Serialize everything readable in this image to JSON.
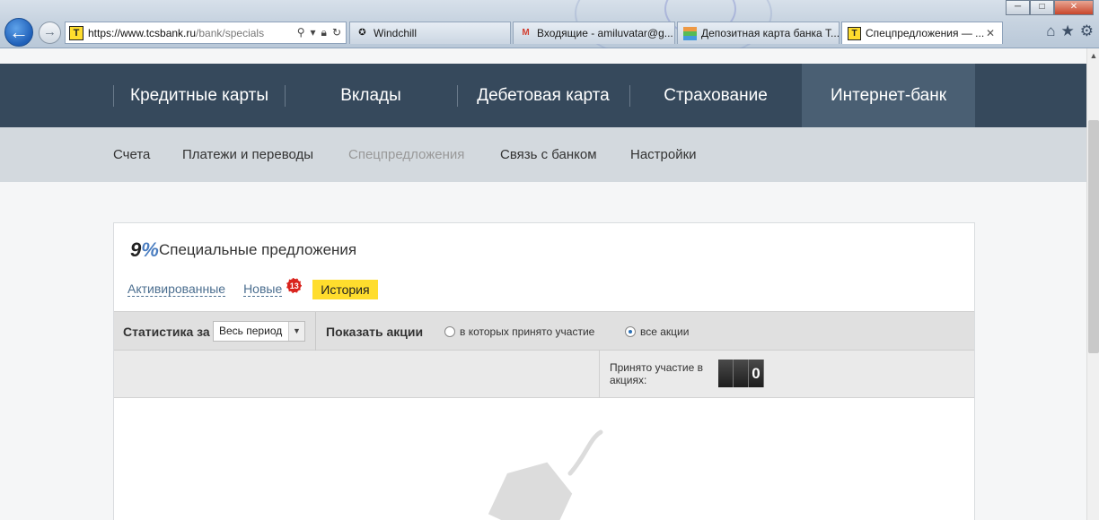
{
  "browser": {
    "address": {
      "url_host": "https://www.tcsbank.ru",
      "url_path": "/bank/specials",
      "site_icon": "T"
    },
    "tabs": [
      {
        "label": "Windchill",
        "icon": "windchill-icon"
      },
      {
        "label": "Входящие - amiluvatar@g...",
        "icon": "gmail-icon"
      },
      {
        "label": "Депозитная карта банка Т...",
        "icon": "bank-chart-icon"
      },
      {
        "label": "Спецпредложения — ...",
        "icon": "tcs-icon"
      }
    ]
  },
  "topnav": {
    "items": [
      {
        "label": "Кредитные карты"
      },
      {
        "label": "Вклады"
      },
      {
        "label": "Дебетовая карта"
      },
      {
        "label": "Страхование"
      },
      {
        "label": "Интернет-банк"
      }
    ]
  },
  "subnav": {
    "items": [
      {
        "label": "Счета"
      },
      {
        "label": "Платежи и переводы"
      },
      {
        "label": "Спецпредложения"
      },
      {
        "label": "Связь с банком"
      },
      {
        "label": "Настройки"
      }
    ]
  },
  "card": {
    "title": "Специальные предложения",
    "filters": {
      "activated": "Активированные",
      "new": "Новые",
      "new_count": "13",
      "history": "История"
    },
    "stats": {
      "label": "Статистика за",
      "period": "Весь период",
      "show_label": "Показать акции",
      "option_participated": "в которых принято участие",
      "option_all": "все акции",
      "selected": "все акции"
    },
    "counter": {
      "label": "Принято участие в акциях:",
      "digits": [
        "",
        "",
        "0"
      ]
    }
  },
  "colors": {
    "topnav_bg": "#36495c",
    "topnav_selected": "#4a5f73",
    "subnav_bg": "#d3d9de",
    "accent_yellow": "#ffdd2d",
    "badge_red": "#d9231d"
  }
}
